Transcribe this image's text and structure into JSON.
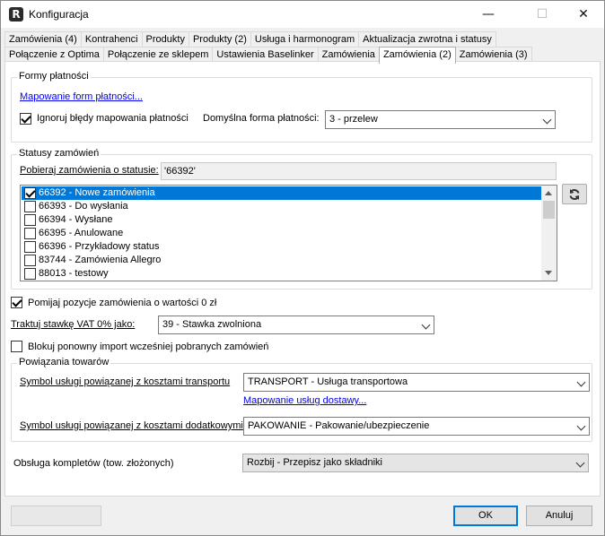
{
  "window": {
    "title": "Konfiguracja",
    "minimize": "—",
    "maximize": "☐",
    "close": "✕"
  },
  "tabs_row1": [
    "Zamówienia (4)",
    "Kontrahenci",
    "Produkty",
    "Produkty (2)",
    "Usługa i harmonogram",
    "Aktualizacja zwrotna i statusy"
  ],
  "tabs_row2": [
    "Połączenie z Optima",
    "Połączenie ze sklepem",
    "Ustawienia Baselinker",
    "Zamówienia",
    "Zamówienia (2)",
    "Zamówienia (3)"
  ],
  "active_tab": "Zamówienia (2)",
  "payments": {
    "group_label": "Formy płatności",
    "mapping_link": "Mapowanie form płatności...",
    "ignore_errors_label": "Ignoruj błędy mapowania płatności",
    "ignore_errors_checked": true,
    "default_label": "Domyślna forma płatności:",
    "default_value": "3 - przelew"
  },
  "statuses": {
    "group_label": "Statusy zamówień",
    "fetch_label": "Pobieraj zamówienia o statusie:",
    "fetch_value": "'66392'",
    "items": [
      {
        "label": "66392 - Nowe zamówienia",
        "checked": true,
        "selected": true
      },
      {
        "label": "66393 - Do wysłania",
        "checked": false,
        "selected": false
      },
      {
        "label": "66394 - Wysłane",
        "checked": false,
        "selected": false
      },
      {
        "label": "66395 - Anulowane",
        "checked": false,
        "selected": false
      },
      {
        "label": "66396 - Przykładowy status",
        "checked": false,
        "selected": false
      },
      {
        "label": "83744 - Zamówienia Allegro",
        "checked": false,
        "selected": false
      },
      {
        "label": "88013 - testowy",
        "checked": false,
        "selected": false
      }
    ]
  },
  "skip_zero": {
    "label": "Pomijaj pozycje zamówienia o wartości 0 zł",
    "checked": true
  },
  "vat": {
    "label": "Traktuj stawkę VAT 0% jako:",
    "value": "39 - Stawka zwolniona"
  },
  "block_reimport": {
    "label": "Blokuj ponowny import wcześniej pobranych zamówień",
    "checked": false
  },
  "products": {
    "group_label": "Powiązania towarów",
    "transport_label": "Symbol usługi powiązanej z kosztami transportu",
    "transport_value": "TRANSPORT - Usługa transportowa",
    "delivery_link": "Mapowanie usług dostawy...",
    "extra_label": "Symbol usługi powiązanej z kosztami dodatkowymi",
    "extra_value": "PAKOWANIE - Pakowanie/ubezpieczenie"
  },
  "bundles": {
    "label": "Obsługa kompletów (tow. złożonych)",
    "value": "Rozbij - Przepisz jako składniki"
  },
  "buttons": {
    "ok": "OK",
    "cancel": "Anuluj"
  }
}
